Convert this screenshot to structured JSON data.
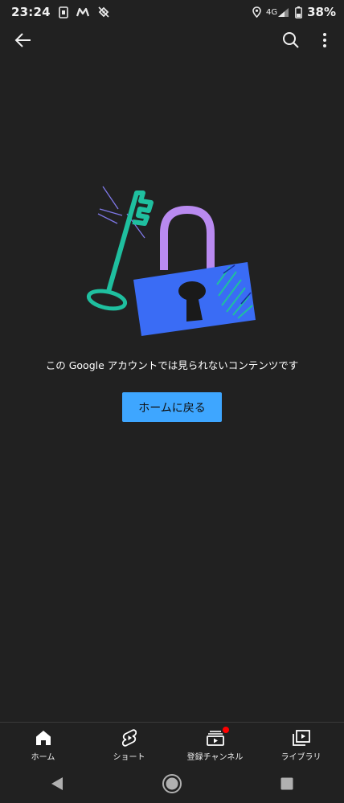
{
  "status_bar": {
    "time": "23:24",
    "network": "4G",
    "battery": "38%",
    "icons": [
      "sim-card-icon",
      "m-app-icon",
      "satellite-off-icon",
      "location-icon",
      "signal-icon",
      "battery-icon"
    ]
  },
  "app_bar": {
    "icons": [
      "back-arrow-icon",
      "search-icon",
      "more-vert-icon"
    ]
  },
  "main": {
    "message": "この Google アカウントでは見られないコンテンツです",
    "home_button_label": "ホームに戻る",
    "illustration": "lock-and-key"
  },
  "bottom_nav": {
    "items": [
      {
        "label": "ホーム",
        "icon": "home-icon",
        "active": true
      },
      {
        "label": "ショート",
        "icon": "shorts-icon",
        "active": false
      },
      {
        "label": "登録チャンネル",
        "icon": "subscriptions-icon",
        "active": false,
        "badge": true
      },
      {
        "label": "ライブラリ",
        "icon": "library-icon",
        "active": false
      }
    ]
  },
  "system_nav": {
    "icons": [
      "back-triangle-icon",
      "home-circle-icon",
      "recents-square-icon"
    ]
  },
  "colors": {
    "background": "#212121",
    "accent_button": "#3ea6ff",
    "lock_body": "#3a6cf5",
    "lock_shackle": "#b98af0",
    "key": "#1fbf9f",
    "badge": "#ff0000"
  }
}
